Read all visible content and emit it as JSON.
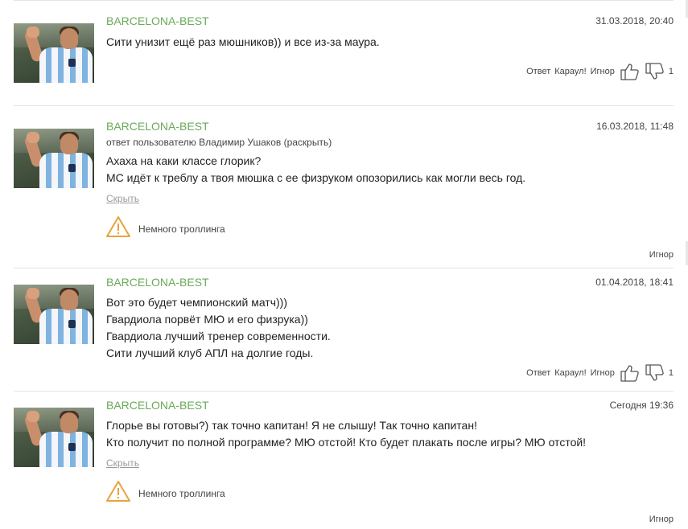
{
  "comments": [
    {
      "author": "BARCELONA-BEST",
      "date": "31.03.2018, 20:40",
      "lines": [
        "Сити унизит ещё раз мюшников)) и все из-за маура."
      ],
      "actions": {
        "reply": "Ответ",
        "alarm": "Караул!",
        "ignore": "Игнор",
        "dislikes": "1"
      }
    },
    {
      "author": "BARCELONA-BEST",
      "date": "16.03.2018, 11:48",
      "reply_to": "ответ пользователю Владимир Ушаков (раскрыть)",
      "lines": [
        "Ахаха на каки классе глорик?",
        "МС идёт к треблу а твоя мюшка с ее физруком опозорились как могли весь год."
      ],
      "hide": "Скрыть",
      "warning": "Немного троллинга",
      "ignore": "Игнор"
    },
    {
      "author": "BARCELONA-BEST",
      "date": "01.04.2018, 18:41",
      "lines": [
        "Вот это будет чемпионский матч)))",
        "Гвардиола порвёт МЮ и его физрука))",
        "Гвардиола лучший тренер современности.",
        "Сити лучший клуб АПЛ на долгие годы."
      ],
      "actions": {
        "reply": "Ответ",
        "alarm": "Караул!",
        "ignore": "Игнор",
        "dislikes": "1"
      }
    },
    {
      "author": "BARCELONA-BEST",
      "date": "Сегодня 19:36",
      "lines": [
        "Глорье вы готовы?) так точно капитан! Я не слышу! Так точно капитан!",
        "Кто получит по полной программе? МЮ отстой! Кто будет плакать после игры? МЮ отстой!"
      ],
      "hide": "Скрыть",
      "warning": "Немного троллинга",
      "ignore": "Игнор"
    }
  ],
  "colors": {
    "author": "#6aaa5a",
    "warning": "#e8a33c",
    "separator": "#e4e4e4"
  },
  "icons": {
    "like": "thumbs-up-icon",
    "dislike": "thumbs-down-icon",
    "warning": "warning-triangle-icon"
  }
}
